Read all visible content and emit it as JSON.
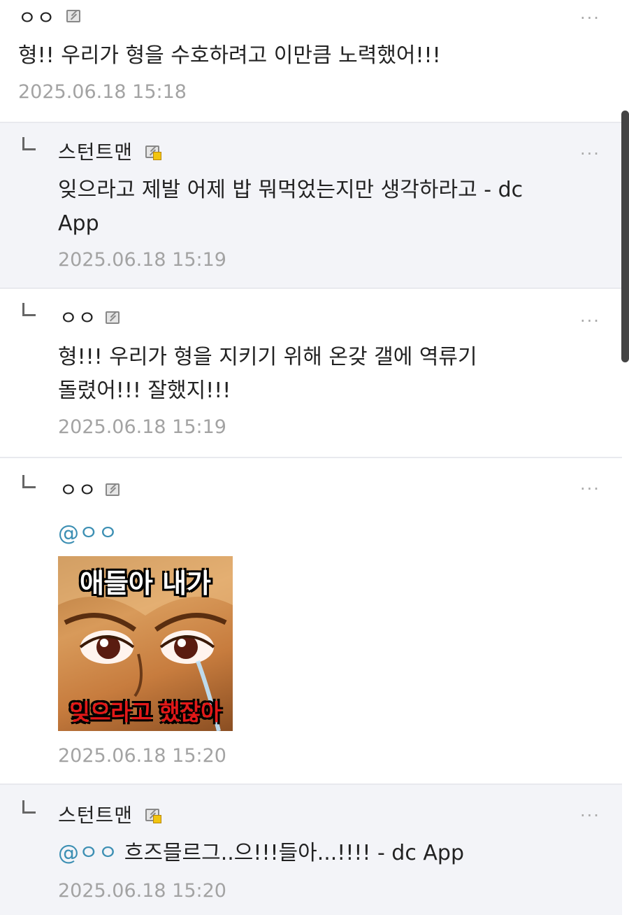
{
  "comments": [
    {
      "nick": "ㅇㅇ",
      "text": "형!! 우리가 형을 수호하려고 이만큼 노력했어!!!",
      "time": "2025.06.18 15:18",
      "more": "···"
    },
    {
      "nick": "스턴트맨",
      "text_line1": "잊으라고 제발 어제 밥 뭐먹었는지만 생각하라고 - dc",
      "text_line2": "App",
      "time": "2025.06.18 15:19",
      "more": "···"
    },
    {
      "nick": "ㅇㅇ",
      "text_line1": "형!!! 우리가 형을 지키기 위해 온갖 갤에 역류기",
      "text_line2": "돌렸어!!! 잘했지!!!",
      "time": "2025.06.18 15:19",
      "more": "···"
    },
    {
      "nick": "ㅇㅇ",
      "mention": "@ㅇㅇ",
      "image_top_text": "애들아 내가",
      "image_bottom_text": "잊으라고 했잖아",
      "time": "2025.06.18 15:20",
      "more": "···"
    },
    {
      "nick": "스턴트맨",
      "mention": "@ㅇㅇ",
      "text": " 흐즈믈르그..으!!!들아...!!!! - dc App",
      "time": "2025.06.18 15:20",
      "more": "···"
    }
  ],
  "icons": {
    "reply": "reply-arrow-icon",
    "badge": "gallery-user-badge-icon",
    "more": "more-options-icon"
  },
  "colors": {
    "mention": "#3c8fb3",
    "timestamp": "#a3a3a3",
    "reply_bg": "#f3f4f8"
  }
}
